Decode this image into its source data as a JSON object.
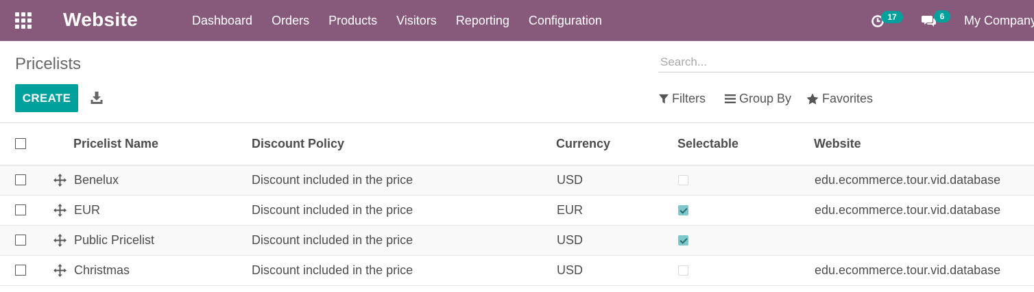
{
  "navbar": {
    "brand": "Website",
    "menu": [
      "Dashboard",
      "Orders",
      "Products",
      "Visitors",
      "Reporting",
      "Configuration"
    ],
    "activity_count": "17",
    "messages_count": "6",
    "company": "My Company",
    "color": "#875a7b"
  },
  "control_panel": {
    "title": "Pricelists",
    "search_placeholder": "Search...",
    "create_label": "CREATE",
    "filters_label": "Filters",
    "group_by_label": "Group By",
    "favorites_label": "Favorites",
    "accent": "#00a09d"
  },
  "table": {
    "columns": [
      "Pricelist Name",
      "Discount Policy",
      "Currency",
      "Selectable",
      "Website"
    ],
    "rows": [
      {
        "name": "Benelux",
        "policy": "Discount included in the price",
        "currency": "USD",
        "selectable": false,
        "website": "edu.ecommerce.tour.vid.database"
      },
      {
        "name": "EUR",
        "policy": "Discount included in the price",
        "currency": "EUR",
        "selectable": true,
        "website": "edu.ecommerce.tour.vid.database"
      },
      {
        "name": "Public Pricelist",
        "policy": "Discount included in the price",
        "currency": "USD",
        "selectable": true,
        "website": ""
      },
      {
        "name": "Christmas",
        "policy": "Discount included in the price",
        "currency": "USD",
        "selectable": false,
        "website": "edu.ecommerce.tour.vid.database"
      }
    ]
  }
}
